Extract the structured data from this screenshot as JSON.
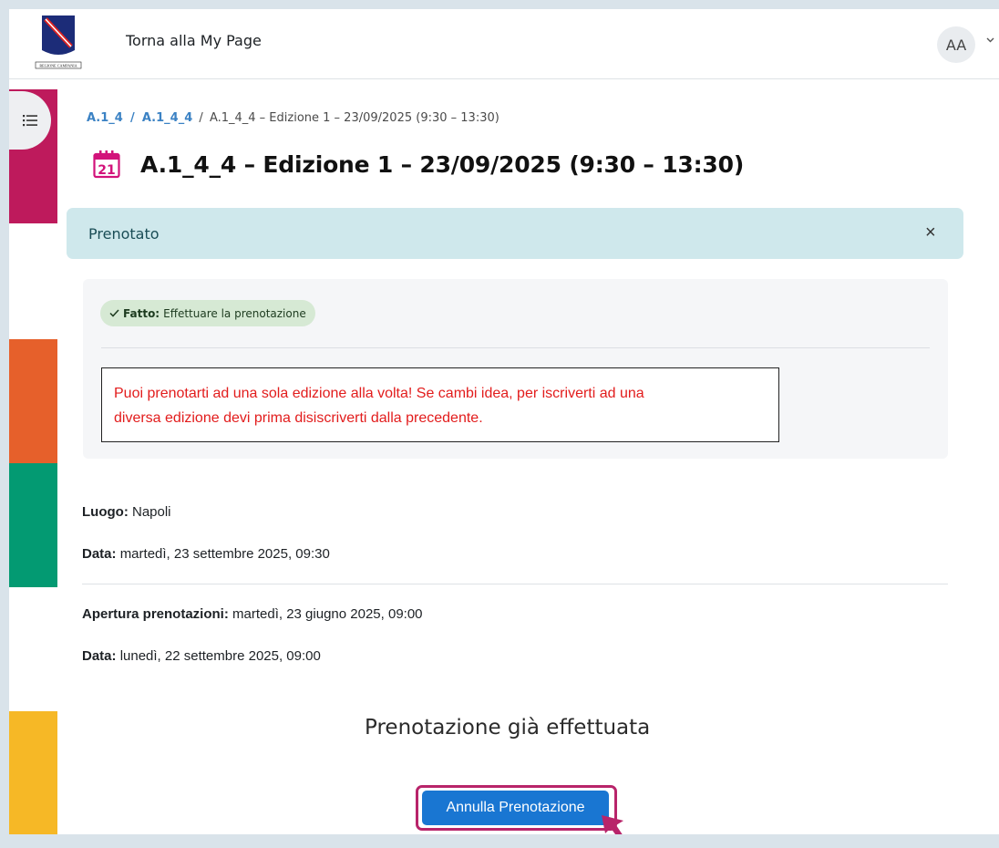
{
  "header": {
    "logo_text": "REGIONE CAMPANIA",
    "back_link": "Torna alla My Page",
    "avatar_initials": "AA"
  },
  "breadcrumb": {
    "items": [
      "A.1_4",
      "A.1_4_4"
    ],
    "separator": "/",
    "current": "A.1_4_4 – Edizione 1 – 23/09/2025 (9:30 – 13:30)"
  },
  "page": {
    "title": "A.1_4_4 – Edizione 1 – 23/09/2025 (9:30 – 13:30)",
    "calendar_icon_day": "21"
  },
  "alert": {
    "text": "Prenotato",
    "close_symbol": "×"
  },
  "completion": {
    "badge_status": "Fatto:",
    "badge_text": "Effettuare la prenotazione",
    "warning_line1": "Puoi prenotarti ad una sola edizione alla volta! Se cambi idea, per iscriverti ad una",
    "warning_line2": "diversa edizione devi prima disiscriverti dalla precedente."
  },
  "details": {
    "location_label": "Luogo:",
    "location_value": "Napoli",
    "date_label": "Data:",
    "date_value": "martedì, 23 settembre 2025, 09:30",
    "booking_open_label": "Apertura prenotazioni:",
    "booking_open_value": "martedì, 23 giugno 2025, 09:00",
    "booking_close_label": "Data:",
    "booking_close_value": "lunedì, 22 settembre 2025, 09:00"
  },
  "booking": {
    "status": "Prenotazione già effettuata",
    "cancel_button": "Annulla Prenotazione"
  },
  "colors": {
    "magenta": "#be1a5c",
    "orange": "#e6602b",
    "green": "#039a72",
    "yellow": "#f6b826",
    "button_blue": "#1976d2",
    "warning_red": "#e21c1c"
  }
}
